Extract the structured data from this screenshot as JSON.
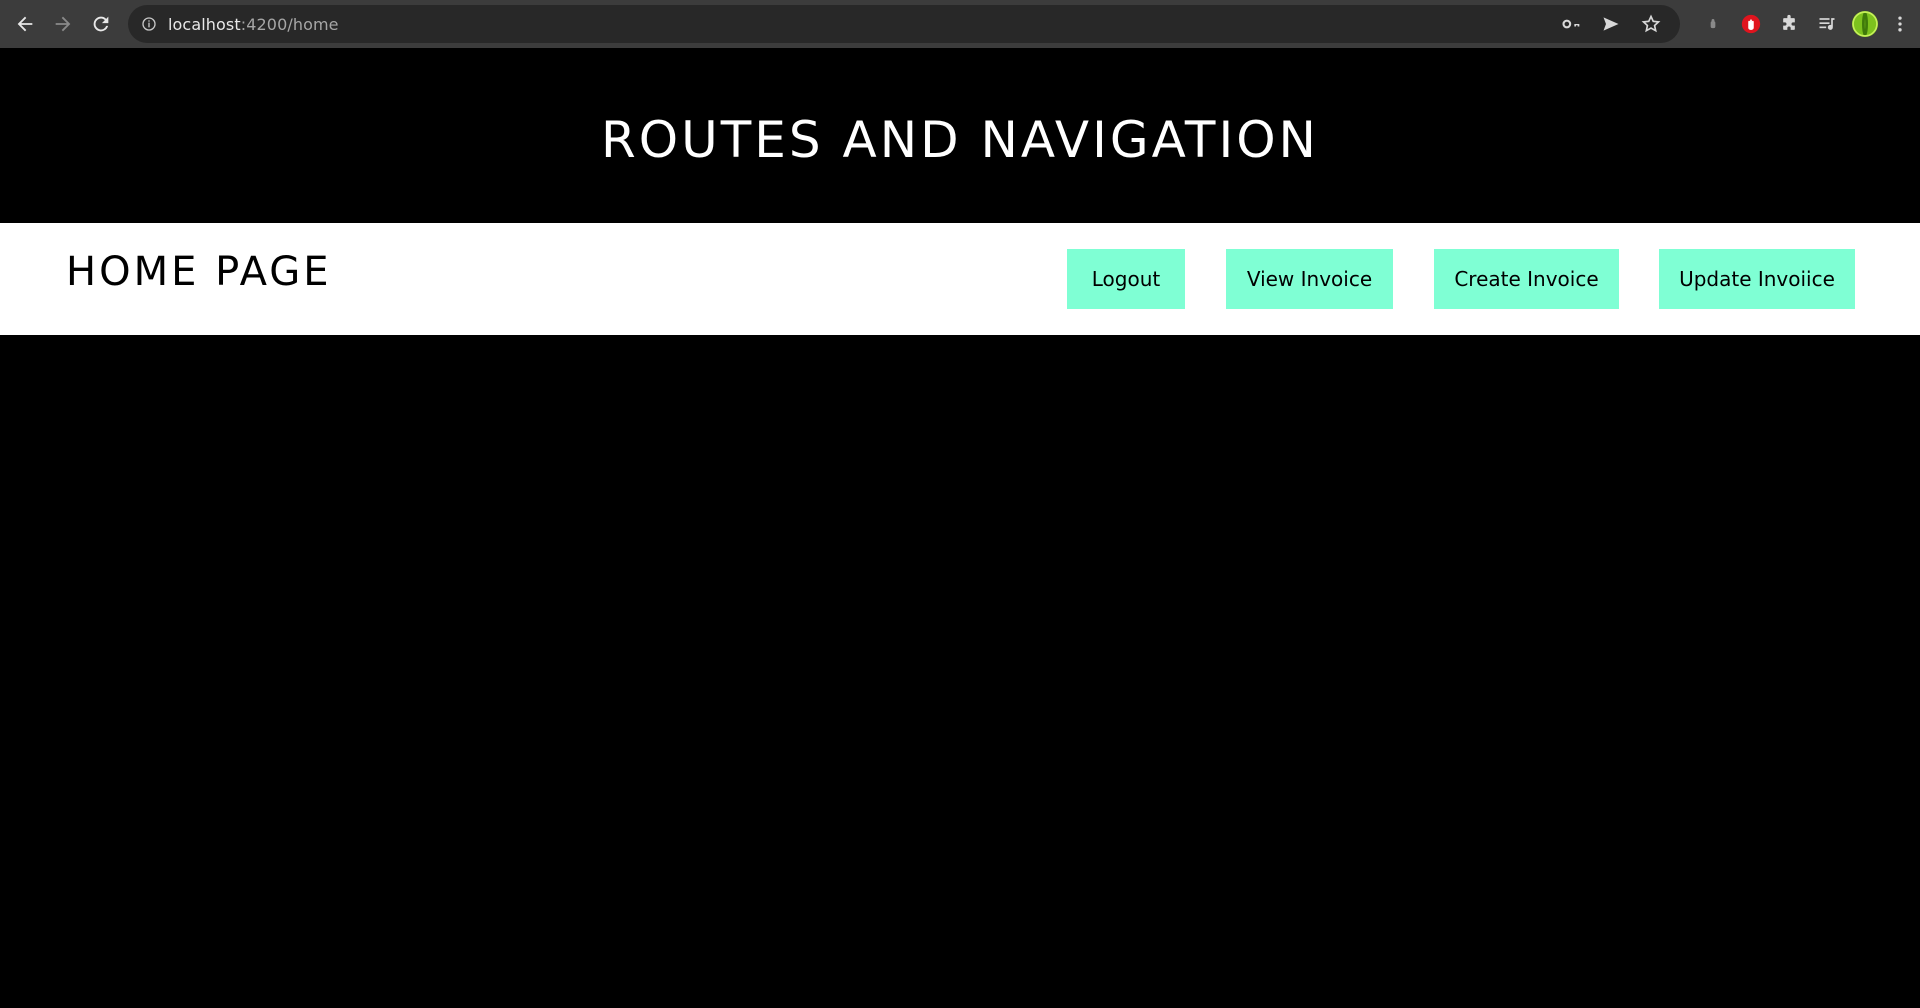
{
  "browser": {
    "url_host": "localhost",
    "url_path": ":4200/home",
    "icons": {
      "back": "arrow-left-icon",
      "forward": "arrow-right-icon",
      "reload": "reload-icon",
      "site_info": "info-icon",
      "password": "key-icon",
      "send": "send-icon",
      "bookmark": "star-icon",
      "extension_1": "puzzle-small-icon",
      "extension_2": "hand-stop-icon",
      "extensions": "puzzle-icon",
      "media": "playlist-icon",
      "profile": "avatar-icon",
      "menu": "kebab-menu-icon"
    }
  },
  "header": {
    "title": "ROUTES AND NAVIGATION"
  },
  "navbar": {
    "page_title": "HOME PAGE",
    "buttons": {
      "logout": "Logout",
      "view_invoice": "View Invoice",
      "create_invoice": "Create Invoice",
      "update_invoice": "Update Invoiice"
    }
  },
  "colors": {
    "page_background": "#000000",
    "navbar_background": "#ffffff",
    "button_background": "#7fffd4",
    "chrome_background": "#3c3c3c"
  }
}
